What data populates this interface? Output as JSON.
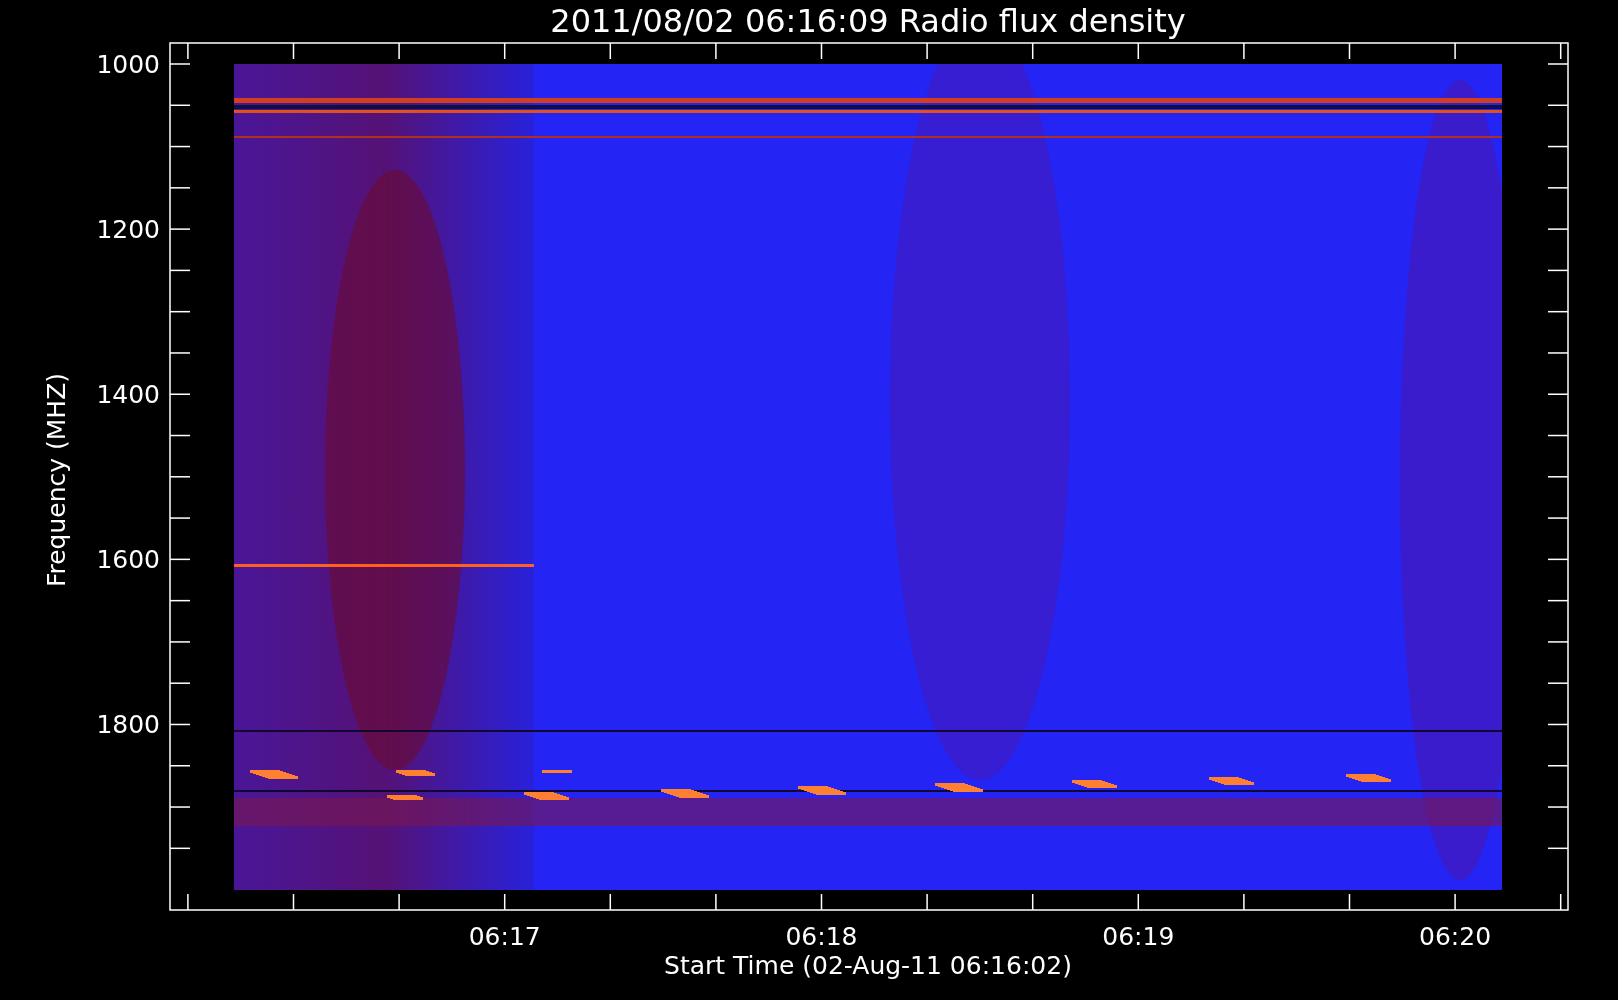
{
  "title": "2011/08/02 06:16:09 Radio flux density",
  "y_axis": {
    "label": "Frequency (MHZ)",
    "tick_labels": [
      "1000",
      "1200",
      "1400",
      "1600",
      "1800"
    ]
  },
  "x_axis": {
    "label": "Start Time (02-Aug-11 06:16:02)",
    "tick_labels": [
      "06:17",
      "06:18",
      "06:19",
      "06:20"
    ]
  }
}
